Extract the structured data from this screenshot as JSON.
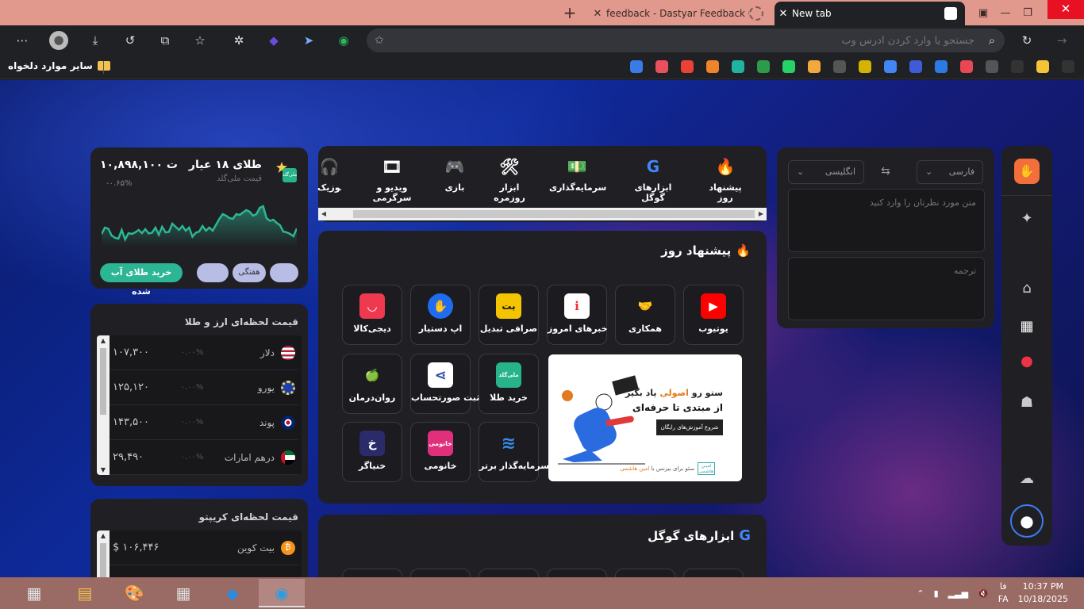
{
  "browser": {
    "tabs": [
      {
        "title": "feedback - Dastyar Feedback Center",
        "active": false
      },
      {
        "title": "New tab",
        "active": true
      }
    ],
    "address_placeholder": "جستجو یا وارد کردن آدرس وب",
    "bookmarks_folder": "سایر موارد دلخواه"
  },
  "gold": {
    "title": "طلای ۱۸ عیار",
    "subtitle": "قیمت ملی‌گلد",
    "price": "۱۰,۸۹۸,۱۰۰ ت",
    "change": "-۰.۶۵%",
    "logo_text": "ملی‌گلد",
    "buy_label": "خرید طلای آب شده",
    "periods": [
      "",
      "هفتگی",
      ""
    ],
    "accent": "#2cb694",
    "series": [
      0.22,
      0.38,
      0.35,
      0.18,
      0.12,
      0.1,
      0.32,
      0.08,
      0.24,
      0.22,
      0.26,
      0.32,
      0.24,
      0.34,
      0.23,
      0.25,
      0.38,
      0.2,
      0.4,
      0.26,
      0.27,
      0.48,
      0.4,
      0.32,
      0.42,
      0.3,
      0.38,
      0.15,
      0.25,
      0.28,
      0.42,
      0.3,
      0.38,
      0.3,
      0.45,
      0.6,
      0.72,
      0.68,
      0.62,
      0.6,
      0.72,
      0.7,
      0.76,
      0.82,
      0.78,
      0.68,
      0.72,
      0.88,
      0.92,
      0.62,
      0.55,
      0.58,
      0.5,
      0.44,
      0.28,
      0.26,
      0.22,
      0.16,
      0.36
    ]
  },
  "currency": {
    "title": "قیمت لحظه‌ای ارز و طلا",
    "rows": [
      {
        "name": "دلار",
        "pct": "۰.۰۰%",
        "value": "۱۰۷,۳۰۰",
        "flag": "us-flag-icon"
      },
      {
        "name": "یورو",
        "pct": "۰.۰۰%",
        "value": "۱۲۵,۱۲۰",
        "flag": "eu-flag-icon"
      },
      {
        "name": "پوند",
        "pct": "۰.۰۰%",
        "value": "۱۴۳,۵۰۰",
        "flag": "uk-flag-icon"
      },
      {
        "name": "درهم امارات",
        "pct": "۰.۰۰%",
        "value": "۲۹,۴۹۰",
        "flag": "uae-flag-icon"
      }
    ]
  },
  "crypto": {
    "title": "قیمت لحظه‌ای کریپتو",
    "rows": [
      {
        "name": "بیت کوین",
        "value": "$ ۱۰۶,۴۴۶",
        "icon": "bitcoin-icon"
      }
    ]
  },
  "categories": [
    {
      "label": "پیشنهاد روز",
      "icon": "🔥",
      "active": true
    },
    {
      "label": "ابزارهای گوگل",
      "icon": "G",
      "active": false
    },
    {
      "label": "سرمایه‌گذاری",
      "icon": "💵",
      "active": false
    },
    {
      "label": "ابزار روزمره",
      "icon": "🛠",
      "active": false
    },
    {
      "label": "بازی",
      "icon": "🎮",
      "active": false
    },
    {
      "label": "ویدیو و سرگرمی",
      "icon": "🎞",
      "active": false
    },
    {
      "label": "موزیک",
      "icon": "🎧",
      "active": false
    }
  ],
  "daily": {
    "title": "پیشنهاد روز",
    "tiles": [
      {
        "label": "یوتیوب",
        "icon": "youtube-icon",
        "color": "#ff0000",
        "glyph": "▶"
      },
      {
        "label": "همکاری",
        "icon": "handshake-icon",
        "color": "#1b1b20",
        "glyph": "🤝"
      },
      {
        "label": "خبرهای امروز",
        "icon": "news-icon",
        "color": "#ffffff",
        "glyph": "i"
      },
      {
        "label": "صرافی تبدیل",
        "icon": "tabdeal-icon",
        "color": "#f5c400",
        "glyph": "بت"
      },
      {
        "label": "اپ دستیار",
        "icon": "dastyar-icon",
        "color": "#1f6cf0",
        "glyph": "✋"
      },
      {
        "label": "دیجی‌کالا",
        "icon": "digikala-icon",
        "color": "#ef394e",
        "glyph": "◡"
      },
      {
        "label": "خرید طلا",
        "icon": "milligold-icon",
        "color": "#27b48a",
        "glyph": "ملی‌گلد"
      },
      {
        "label": "ثبت صورتحساب",
        "icon": "invoice-icon",
        "color": "#ffffff",
        "glyph": "⋖"
      },
      {
        "label": "روان‌درمان",
        "icon": "psychotherapy-icon",
        "color": "#1b1b20",
        "glyph": "🍏"
      },
      {
        "label": "سرمایه‌گذار برتر",
        "icon": "investor-icon",
        "color": "#1b1b20",
        "glyph": "≋"
      },
      {
        "label": "خانومی",
        "icon": "khanoomi-icon",
        "color": "#e0307c",
        "glyph": "خانومی"
      },
      {
        "label": "خنیاگر",
        "icon": "khonyagar-icon",
        "color": "#2b2a6a",
        "glyph": "خ"
      }
    ],
    "banner": {
      "line1_a": "ستو رو ",
      "line1_b": "اصولی",
      "line1_c": " یاد بگیر",
      "line2": "از مبتدی تا حرفه‌ای",
      "cta": "شروع آموزش‌های رایگان",
      "footer_a": "سئو برای بیزنس با ",
      "footer_b": "امین هاشمی",
      "logo": "آمیـن هاشمی"
    }
  },
  "google_tools": {
    "title": "ابزارهای گوگل"
  },
  "translator": {
    "source_lang": "فارسی",
    "target_lang": "انگلیسی",
    "input_placeholder": "متن مورد نظرتان را وارد کنید",
    "output_placeholder": "ترجمه"
  },
  "taskbar": {
    "time": "10:37 PM",
    "date": "10/18/2025",
    "lang_top": "فا",
    "lang_bottom": "FA"
  }
}
